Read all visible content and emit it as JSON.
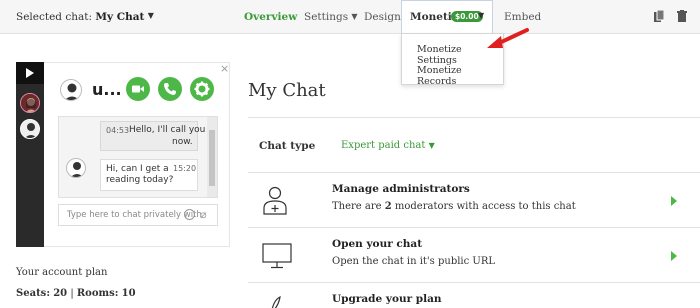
{
  "header": {
    "selected_label": "Selected chat:",
    "selected_value": "My Chat",
    "tabs": [
      {
        "label": "Overview"
      },
      {
        "label": "Settings"
      },
      {
        "label": "Design"
      },
      {
        "label": "Monetize"
      },
      {
        "label": "Embed"
      }
    ],
    "monetize_badge": "$0.00"
  },
  "dropdown": {
    "items": [
      "Monetize Settings",
      "Monetize Records"
    ]
  },
  "widget": {
    "user_name": "u...",
    "messages": [
      {
        "time": "04:53",
        "text_line1": "Hello, I'll call you",
        "text_line2": "now."
      },
      {
        "time": "15:20",
        "text_line1": "Hi, can I get a",
        "text_line2": "reading today?"
      }
    ],
    "input_placeholder": "Type here to chat privately with",
    "close": "×"
  },
  "sidebar_info": {
    "plan_label": "Your account plan",
    "seats_label": "Seats:",
    "seats_value": "20",
    "separator": "|",
    "rooms_label": "Rooms:",
    "rooms_value": "10"
  },
  "main": {
    "title": "My Chat",
    "chat_type_label": "Chat type",
    "chat_type_value": "Expert paid chat",
    "rows": [
      {
        "title": "Manage administrators",
        "desc_prefix": "There are ",
        "desc_count": "2",
        "desc_suffix": " moderators with access to this chat",
        "icon": "user-plus-icon"
      },
      {
        "title": "Open your chat",
        "desc": "Open the chat in it's public URL",
        "icon": "monitor-icon"
      },
      {
        "title": "Upgrade your plan",
        "icon": "rocket-icon"
      }
    ]
  },
  "colors": {
    "accent_green": "#4db848",
    "text_green": "#3a9a3a",
    "arrow_red": "#e02020"
  }
}
